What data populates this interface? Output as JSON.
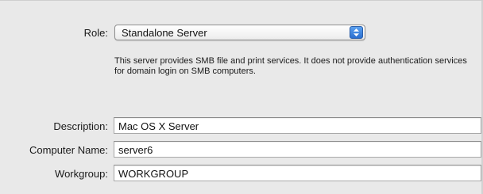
{
  "role": {
    "label": "Role:",
    "selected": "Standalone Server",
    "description": "This server provides SMB file and print services. It does not provide authentication services for domain login on SMB computers."
  },
  "fields": {
    "description_label": "Description:",
    "description_value": "Mac OS X Server",
    "computer_name_label": "Computer Name:",
    "computer_name_value": "server6",
    "workgroup_label": "Workgroup:",
    "workgroup_value": "WORKGROUP"
  },
  "icons": {
    "popup_stepper": "up-down-arrows-icon"
  },
  "colors": {
    "background": "#e9e9e9",
    "stepper_blue": "#2b6fd0"
  }
}
